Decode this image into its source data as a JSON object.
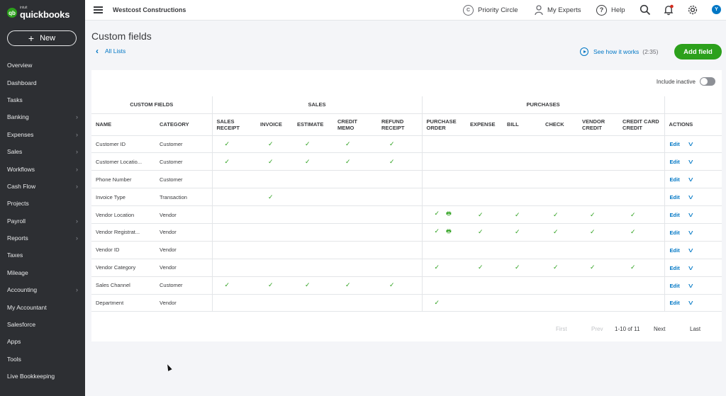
{
  "brand": {
    "small": "intuit",
    "name": "quickbooks",
    "mark": "qb"
  },
  "sidebar": {
    "new_label": "New",
    "items": [
      {
        "label": "Overview",
        "chevron": false
      },
      {
        "label": "Dashboard",
        "chevron": false
      },
      {
        "label": "Tasks",
        "chevron": false
      },
      {
        "label": "Banking",
        "chevron": true
      },
      {
        "label": "Expenses",
        "chevron": true
      },
      {
        "label": "Sales",
        "chevron": true
      },
      {
        "label": "Workflows",
        "chevron": true
      },
      {
        "label": "Cash Flow",
        "chevron": true
      },
      {
        "label": "Projects",
        "chevron": false
      },
      {
        "label": "Payroll",
        "chevron": true
      },
      {
        "label": "Reports",
        "chevron": true
      },
      {
        "label": "Taxes",
        "chevron": false
      },
      {
        "label": "Mileage",
        "chevron": false
      },
      {
        "label": "Accounting",
        "chevron": true
      },
      {
        "label": "My Accountant",
        "chevron": false
      },
      {
        "label": "Salesforce",
        "chevron": false
      },
      {
        "label": "Apps",
        "chevron": false
      },
      {
        "label": "Tools",
        "chevron": false
      },
      {
        "label": "Live Bookkeeping",
        "chevron": false
      }
    ]
  },
  "topbar": {
    "company": "Westcost Constructions",
    "priority_circle": "Priority Circle",
    "my_experts": "My Experts",
    "help": "Help",
    "avatar_initial": "Y"
  },
  "page": {
    "title": "Custom fields",
    "back_link": "All Lists",
    "see_how": "See how it works",
    "see_how_duration": "(2:35)",
    "add_field": "Add field",
    "include_inactive": "Include inactive"
  },
  "table": {
    "groups": {
      "custom": "CUSTOM FIELDS",
      "sales": "SALES",
      "purchases": "PURCHASES"
    },
    "headers": {
      "name": "NAME",
      "category": "CATEGORY",
      "sales_receipt": "SALES RECEIPT",
      "invoice": "INVOICE",
      "estimate": "ESTIMATE",
      "credit_memo": "CREDIT MEMO",
      "refund_receipt": "REFUND RECEIPT",
      "purchase_order": "PURCHASE ORDER",
      "expense": "EXPENSE",
      "bill": "BILL",
      "check": "CHECK",
      "vendor_credit": "VENDOR CREDIT",
      "credit_card_credit": "CREDIT CARD CREDIT",
      "actions": "ACTIONS"
    },
    "check_glyph": "✓",
    "print_glyph": "🖶",
    "edit_label": "Edit",
    "rows": [
      {
        "name": "Customer ID",
        "category": "Customer",
        "checks": [
          1,
          1,
          1,
          1,
          1,
          0,
          0,
          0,
          0,
          0,
          0
        ],
        "po_print": false
      },
      {
        "name": "Customer Locatio...",
        "category": "Customer",
        "checks": [
          1,
          1,
          1,
          1,
          1,
          0,
          0,
          0,
          0,
          0,
          0
        ],
        "po_print": false
      },
      {
        "name": "Phone Number",
        "category": "Customer",
        "checks": [
          0,
          0,
          0,
          0,
          0,
          0,
          0,
          0,
          0,
          0,
          0
        ],
        "po_print": false
      },
      {
        "name": "Invoice Type",
        "category": "Transaction",
        "checks": [
          0,
          1,
          0,
          0,
          0,
          0,
          0,
          0,
          0,
          0,
          0
        ],
        "po_print": false
      },
      {
        "name": "Vendor Location",
        "category": "Vendor",
        "checks": [
          0,
          0,
          0,
          0,
          0,
          1,
          1,
          1,
          1,
          1,
          1
        ],
        "po_print": true
      },
      {
        "name": "Vendor Registrat...",
        "category": "Vendor",
        "checks": [
          0,
          0,
          0,
          0,
          0,
          1,
          1,
          1,
          1,
          1,
          1
        ],
        "po_print": true
      },
      {
        "name": "Vendor ID",
        "category": "Vendor",
        "checks": [
          0,
          0,
          0,
          0,
          0,
          0,
          0,
          0,
          0,
          0,
          0
        ],
        "po_print": false
      },
      {
        "name": "Vendor Category",
        "category": "Vendor",
        "checks": [
          0,
          0,
          0,
          0,
          0,
          1,
          1,
          1,
          1,
          1,
          1
        ],
        "po_print": false
      },
      {
        "name": "Sales Channel",
        "category": "Customer",
        "checks": [
          1,
          1,
          1,
          1,
          1,
          0,
          0,
          0,
          0,
          0,
          0
        ],
        "po_print": false
      },
      {
        "name": "Department",
        "category": "Vendor",
        "checks": [
          0,
          0,
          0,
          0,
          0,
          1,
          0,
          0,
          0,
          0,
          0
        ],
        "po_print": false
      }
    ]
  },
  "pagination": {
    "first": "First",
    "prev": "Prev",
    "range": "1-10 of 11",
    "next": "Next",
    "last": "Last"
  },
  "colors": {
    "brand_green": "#2ca01c",
    "link_blue": "#0077c5",
    "sidebar_bg": "#2d2f33"
  }
}
